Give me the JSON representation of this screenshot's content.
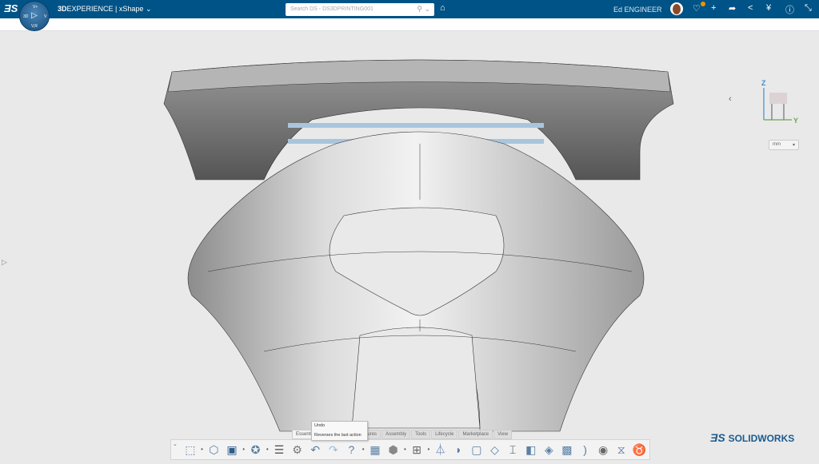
{
  "topbar": {
    "brand_bold": "3D",
    "brand_rest": "EXPERIENCE |",
    "app": "xShape",
    "compass_labels": {
      "top": "V+",
      "left": "3D",
      "right": "V",
      "bottom": "V,R"
    },
    "search_placeholder": "Search DS - DS3DPRINTING001",
    "user": "Ed ENGINEER",
    "notification_count": "1",
    "accent": "#005386"
  },
  "viewport": {
    "unit": "mm",
    "triad": {
      "z": "Z",
      "y": "Y"
    }
  },
  "tabs": [
    "Essentials",
    "ion",
    "Features",
    "Assembly",
    "Tools",
    "Lifecycle",
    "Marketplace",
    "View"
  ],
  "tooltip": {
    "title": "Undo",
    "description": "Reverses the last action"
  },
  "toolbar": {
    "icons": [
      "new-icon",
      "open-part-icon",
      "save-icon",
      "lifecycle-icon",
      "properties-icon",
      "settings-icon",
      "undo-icon",
      "redo-icon",
      "help-icon",
      "grid-plane-icon",
      "display-style-icon",
      "subdivision-grid-icon",
      "point-surface-icon",
      "face-icon",
      "box-face-icon",
      "patch-icon",
      "bridge-icon",
      "fill-icon",
      "blend-icon"
    ]
  },
  "logo": {
    "text": "SOLIDWORKS"
  }
}
